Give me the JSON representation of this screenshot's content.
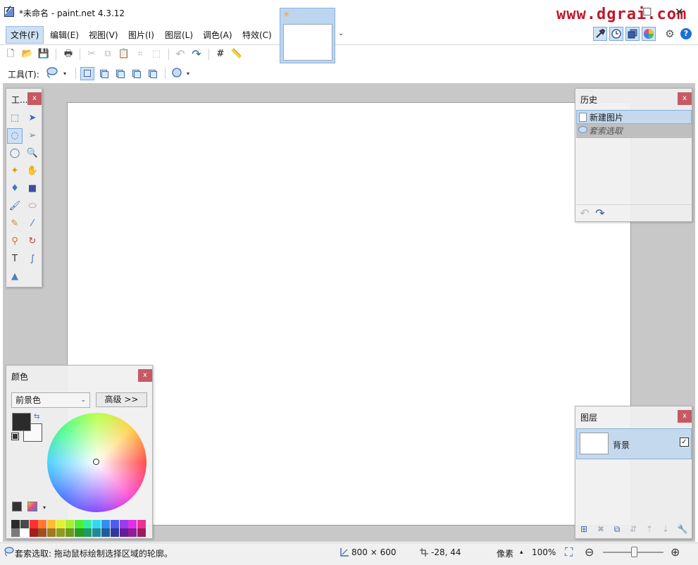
{
  "window": {
    "title": "*未命名 - paint.net 4.3.12",
    "watermark": "www.dgrai.com",
    "maximize_glyph": "☐",
    "close_glyph": "✕"
  },
  "menu": {
    "items": [
      "文件(F)",
      "编辑(E)",
      "视图(V)",
      "图片(I)",
      "图层(L)",
      "调色(A)",
      "特效(C)"
    ],
    "active": "文件(F)"
  },
  "image_tabs": {
    "thumbnail_badge": "✳",
    "overflow_arrow": "⌄"
  },
  "right_toolbar": {
    "icons": [
      "tools-window-icon",
      "history-window-icon",
      "layers-window-icon",
      "colors-window-icon",
      "settings-gear-icon",
      "help-icon"
    ],
    "gear_glyph": "⚙",
    "help_glyph": "?"
  },
  "toolbar": {
    "icons": [
      "new-file-icon",
      "open-file-icon",
      "save-file-icon",
      "print-icon",
      "cut-icon",
      "copy-icon",
      "paste-icon",
      "crop-to-selection-icon",
      "deselect-icon",
      "undo-icon",
      "redo-icon",
      "grid-icon",
      "ruler-icon"
    ],
    "glyphs": {
      "new": "🗋",
      "open": "📂",
      "save": "💾",
      "print": "🖶",
      "cut": "✂",
      "copy": "⧉",
      "paste": "📋",
      "crop": "⌗",
      "deselect": "⬚",
      "undo": "↶",
      "redo": "↷",
      "grid": "#",
      "ruler": "📏"
    }
  },
  "tool_options": {
    "label": "工具(T):",
    "current_tool_icon": "lasso-select-icon",
    "selection_modes": [
      "replace",
      "union",
      "exclude",
      "intersect",
      "invert"
    ],
    "active_mode": "replace",
    "antialias_icon": "antialiasing-icon",
    "dropdown_glyph": "▾"
  },
  "tools_panel": {
    "title": "工...",
    "close": "x",
    "active_tool": "lasso-select",
    "tools": [
      {
        "name": "rectangle-select",
        "glyph": "⬚",
        "color": "#3a6ab0"
      },
      {
        "name": "move-selected-pixels",
        "glyph": "➤",
        "color": "#3a6ab0"
      },
      {
        "name": "lasso-select",
        "glyph": "◌",
        "color": "#3a6ab0"
      },
      {
        "name": "move-selection",
        "glyph": "➢",
        "color": "#6b86a8"
      },
      {
        "name": "ellipse-select",
        "glyph": "◯",
        "color": "#3a6ab0"
      },
      {
        "name": "zoom",
        "glyph": "🔍",
        "color": "#2b5aa0"
      },
      {
        "name": "magic-wand",
        "glyph": "✦",
        "color": "#d0a000"
      },
      {
        "name": "pan",
        "glyph": "✋",
        "color": "#d99a2b"
      },
      {
        "name": "paint-bucket",
        "glyph": "♦",
        "color": "#3a78c4"
      },
      {
        "name": "gradient",
        "glyph": "■",
        "color": "#3c4ea0"
      },
      {
        "name": "paintbrush",
        "glyph": "🖌",
        "color": "#2c5aa0"
      },
      {
        "name": "eraser",
        "glyph": "⬭",
        "color": "#d65a8a"
      },
      {
        "name": "pencil",
        "glyph": "✎",
        "color": "#c98a2b"
      },
      {
        "name": "color-picker",
        "glyph": "⁄",
        "color": "#3a6ab0"
      },
      {
        "name": "clone-stamp",
        "glyph": "⚲",
        "color": "#c8741c"
      },
      {
        "name": "recolor",
        "glyph": "↻",
        "color": "#c04040"
      },
      {
        "name": "text",
        "glyph": "T",
        "color": "#333333"
      },
      {
        "name": "line-curve",
        "glyph": "∫",
        "color": "#3a6ab0"
      },
      {
        "name": "shapes",
        "glyph": "▲",
        "color": "#4a7fc0"
      }
    ]
  },
  "history_panel": {
    "title": "历史",
    "close": "x",
    "items": [
      {
        "label": "新建图片",
        "icon": "new-image-icon",
        "state": "selected"
      },
      {
        "label": "套索选取",
        "icon": "lasso-select-icon",
        "state": "undone"
      }
    ],
    "undo_glyph": "↶",
    "redo_glyph": "↷"
  },
  "colors_panel": {
    "title": "颜色",
    "close": "x",
    "mode_select": "前景色",
    "more_button": "高级 >>",
    "primary_color": "#2b2b2b",
    "secondary_color": "#fafafa",
    "swap_glyph": "⇆",
    "palette_row1": [
      "#2b2b2b",
      "#4a4a4a",
      "#ff3030",
      "#ff7a30",
      "#ffbe30",
      "#e6f030",
      "#a6f030",
      "#4cf030",
      "#30f0a0",
      "#30d8f0",
      "#3090f0",
      "#4c5cf0",
      "#9c3cf0",
      "#e030e6",
      "#f03090"
    ],
    "palette_row2": [
      "#7a7a7a",
      "#ffffff",
      "#a02020",
      "#a04e20",
      "#a07a20",
      "#909a20",
      "#6a9a20",
      "#2a9a20",
      "#209a64",
      "#208a9a",
      "#205c9a",
      "#30389a",
      "#621e9a",
      "#901e94",
      "#9a1e5c"
    ]
  },
  "layers_panel": {
    "title": "图层",
    "close": "x",
    "layers": [
      {
        "name": "背景",
        "visible": true
      }
    ],
    "visible_glyph": "✓",
    "tool_glyphs": [
      "⊞",
      "✖",
      "⧉",
      "⇵",
      "⇡",
      "⇣",
      "🔧"
    ]
  },
  "statusbar": {
    "hint": "套索选取: 拖动鼠标绘制选择区域的轮廓。",
    "image_size": "800 × 600",
    "cursor_pos": "-28, 44",
    "units": "像素",
    "units_arrow": "▴",
    "zoom": "100%",
    "zoom_fit_glyph": "⛶",
    "zoom_out_glyph": "⊖",
    "zoom_in_glyph": "⊕",
    "zoom_slider_value": 0.5
  }
}
